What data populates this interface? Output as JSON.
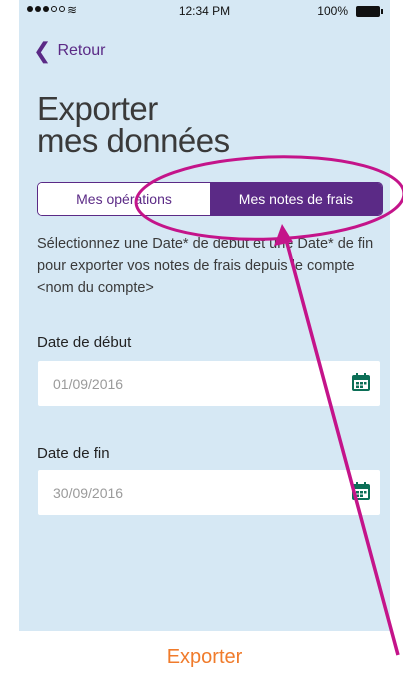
{
  "status_bar": {
    "time": "12:34 PM",
    "battery": "100%",
    "wifi_icon": "wifi-icon"
  },
  "nav": {
    "back_label": "Retour"
  },
  "title": {
    "line1": "Exporter",
    "line2": "mes données"
  },
  "tabs": [
    {
      "label": "Mes opérations",
      "selected": false
    },
    {
      "label": "Mes notes de frais",
      "selected": true
    }
  ],
  "description": "Sélectionnez une Date* de début et une Date* de fin pour exporter vos notes de frais depuis le compte <nom du compte>",
  "start_date": {
    "label": "Date de début",
    "value": "01/09/2016"
  },
  "end_date": {
    "label": "Date de fin",
    "value": "30/09/2016"
  },
  "footer": {
    "export_label": "Exporter"
  },
  "colors": {
    "accent": "#5b2a86",
    "background": "#d6e8f4",
    "export": "#f07b2b",
    "annotation": "#c4148a",
    "calendar": "#0c6f57"
  }
}
